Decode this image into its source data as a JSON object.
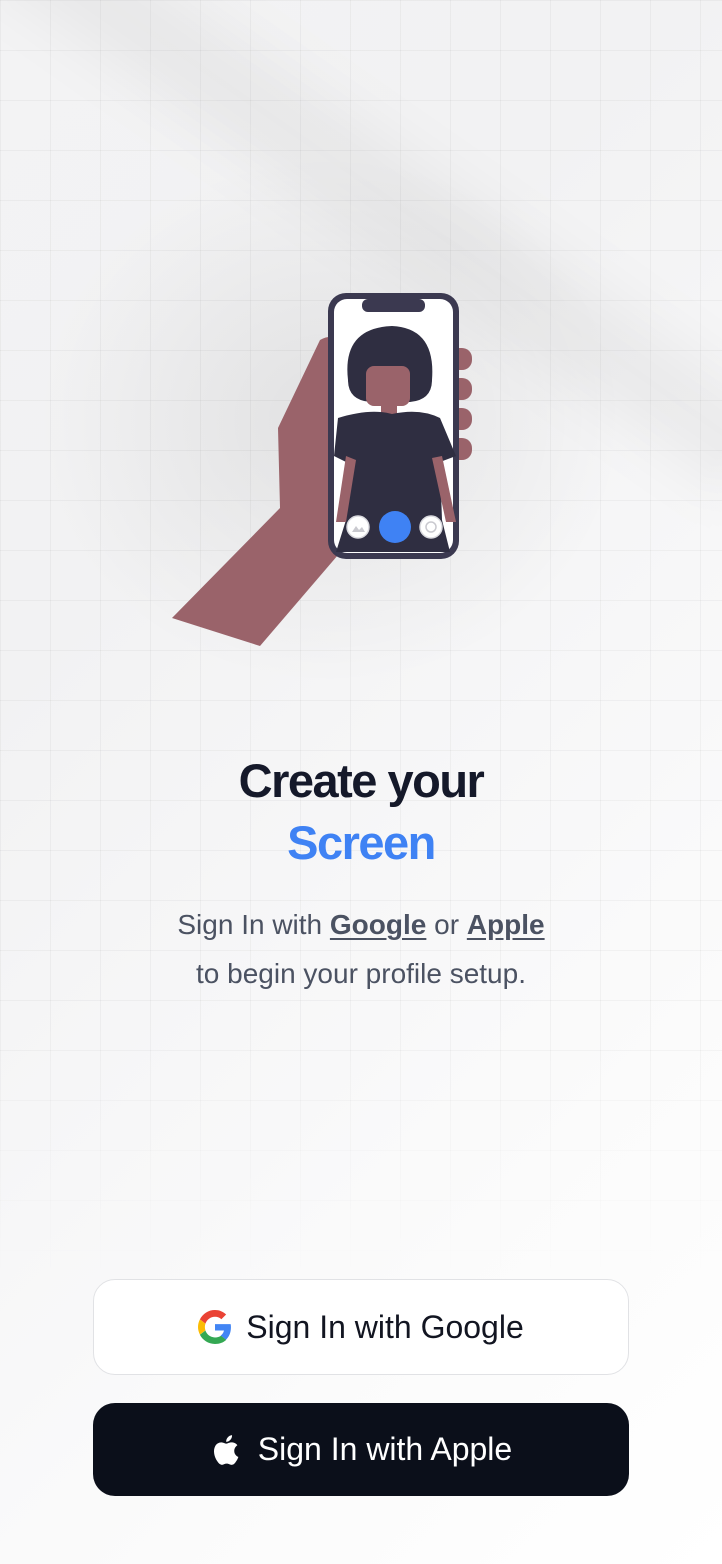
{
  "hero": {
    "title_line1": "Create your",
    "title_line2": "Screen",
    "title_accent_color": "#3f82f4"
  },
  "subtitle": {
    "prefix": "Sign In with ",
    "google_link": "Google",
    "middle": " or ",
    "apple_link": "Apple",
    "line2": "to begin your profile setup."
  },
  "buttons": {
    "google": {
      "label": "Sign In with Google",
      "icon": "google-icon"
    },
    "apple": {
      "label": "Sign In with Apple",
      "icon": "apple-icon"
    }
  },
  "illustration": {
    "icon": "phone-selfie-illustration",
    "capture_button_color": "#3f82f4"
  }
}
